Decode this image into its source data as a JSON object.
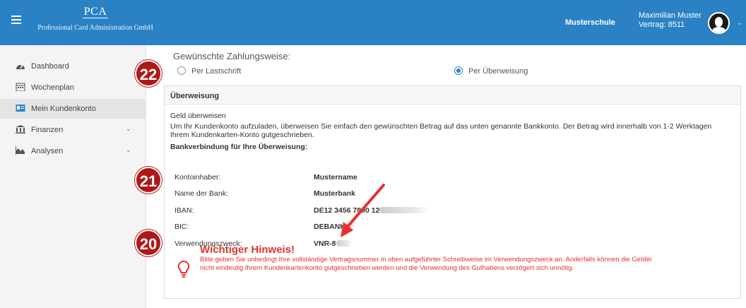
{
  "header": {
    "logo_title": "PCA",
    "logo_subtitle": "Professional Card Administration GmbH",
    "school": "Musterschule",
    "user_name": "Maximilian Muster",
    "user_contract": "Vertrag: 8511",
    "brand_color": "#2a82c4"
  },
  "sidebar": {
    "items": [
      {
        "label": "Dashboard",
        "icon": "dashboard-icon"
      },
      {
        "label": "Wochenplan",
        "icon": "calendar-icon"
      },
      {
        "label": "Mein Kundenkonto",
        "icon": "id-card-icon",
        "active": true
      },
      {
        "label": "Finanzen",
        "icon": "bank-icon",
        "expandable": true
      },
      {
        "label": "Analysen",
        "icon": "area-chart-icon",
        "expandable": true
      }
    ]
  },
  "payment": {
    "title": "Gewünschte Zahlungsweise:",
    "option_direct_debit": "Per Lastschrift",
    "option_transfer": "Per Überweisung",
    "selected": "Per Überweisung"
  },
  "panel": {
    "title": "Überweisung",
    "section": "Geld überweisen",
    "instructions_line1": "Um Ihr Kundenkonto aufzuladen, überweisen Sie einfach den gewünschten Betrag auf das unten genannte Bankkonto. Der Betrag wird innerhalb von 1-2 Werktagen",
    "instructions_line2": "Ihrem Kundenkarten-Konto gutgeschrieben.",
    "bank_heading": "Bankverbindung für Ihre Überweisung:",
    "rows": [
      {
        "label": "Kontoinhaber:",
        "value": "Mustername"
      },
      {
        "label": "Name der Bank:",
        "value": "Musterbank"
      },
      {
        "label": "IBAN:",
        "value": "DE12 3456 7890 12"
      },
      {
        "label": "BIC:",
        "value": "DEBANK"
      },
      {
        "label": "Verwendungszweck:",
        "value": "VNR-8"
      }
    ],
    "notice_title": "Wichtiger Hinweis!",
    "notice_line1": "Bitte geben Sie unbedingt Ihre vollständige Vertragsnummer in oben aufgeführter Schreibweise im Verwendungszweck an. Anderfalls können die Gelder",
    "notice_line2": "nicht eindeutig Ihrem Kundenkartenkonto gutgeschrieben werden und die Verwendung des Guthabens verzögert sich unnötig.",
    "notice_color": "#e5312f"
  },
  "markers": [
    "22",
    "21",
    "20"
  ],
  "marker_color": "#b01818"
}
